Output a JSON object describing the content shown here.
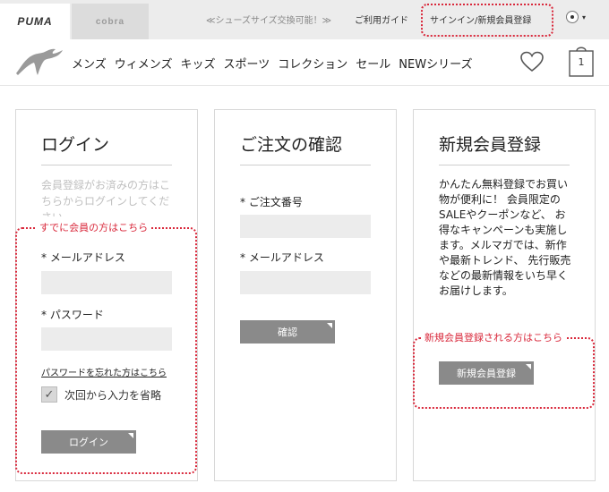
{
  "topbar": {
    "brand_puma": "PUMA",
    "brand_cobra": "cobra",
    "promo": "≪シューズサイズ交換可能！≫",
    "guide": "ご利用ガイド",
    "signin": "サインイン/新規会員登録",
    "locale_caret": "▾"
  },
  "nav": {
    "items": [
      "メンズ",
      "ウィメンズ",
      "キッズ",
      "スポーツ",
      "コレクション",
      "セール",
      "NEWシリーズ"
    ],
    "cart_count": "1"
  },
  "login": {
    "title": "ログイン",
    "description": "会員登録がお済みの方はこちらからログインしてください",
    "email_label": "* メールアドレス",
    "password_label": "* パスワード",
    "forgot": "パスワードを忘れた方はこちら",
    "remember": "次回から入力を省略",
    "button": "ログイン",
    "checkmark": "✓"
  },
  "order": {
    "title": "ご注文の確認",
    "order_number_label": "* ご注文番号",
    "email_label": "* メールアドレス",
    "button": "確認"
  },
  "register": {
    "title": "新規会員登録",
    "description": "かんたん無料登録でお買い物が便利に！ 会員限定のSALEやクーポンなど、 お得なキャンペーンも実施します。メルマガでは、新作や最新トレンド、 先行販売などの最新情報をいち早くお届けします。",
    "button": "新規会員登録"
  },
  "annotations": {
    "login": "すでに会員の方はこちら",
    "register": "新規会員登録される方はこちら"
  },
  "colors": {
    "annotation": "#d9283b",
    "button": "#8a8a8a",
    "input": "#ececec"
  }
}
